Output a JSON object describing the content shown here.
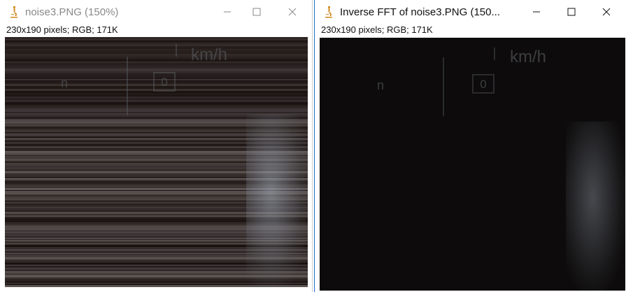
{
  "windows": [
    {
      "title": "noise3.PNG (150%)",
      "info": "230x190 pixels; RGB; 171K",
      "image": {
        "left_text": "n",
        "unit_text": "km/h",
        "box_text": "0"
      }
    },
    {
      "title": "Inverse FFT of noise3.PNG (150...",
      "info": "230x190 pixels; RGB; 171K",
      "image": {
        "left_text": "n",
        "unit_text": "km/h",
        "box_text": "0"
      }
    }
  ],
  "icons": {
    "app": "microscope-icon",
    "minimize": "minimize-icon",
    "maximize": "maximize-icon",
    "close": "close-icon"
  },
  "colors": {
    "active_border": "#1e6fd0",
    "noisy_image_base": "#2a2523",
    "fft_image_base": "#0d0b0b"
  }
}
